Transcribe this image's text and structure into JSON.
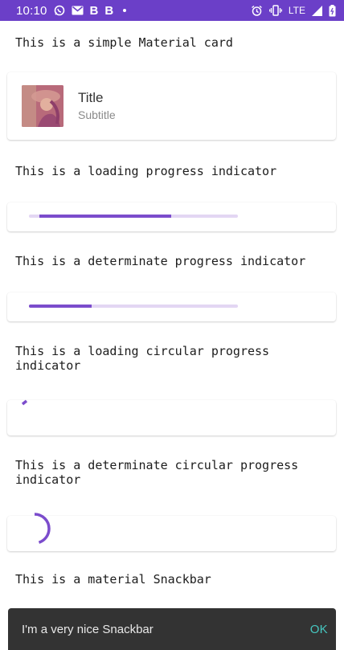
{
  "status_bar": {
    "time": "10:10",
    "left_icons": [
      "whatsapp-icon",
      "gmail-icon",
      "b-app-icon",
      "b-app-icon",
      "dot-icon"
    ],
    "b_label": "B",
    "network_label": "LTE",
    "right_icons": [
      "alarm-icon",
      "vibrate-icon",
      "signal-icon",
      "battery-icon"
    ]
  },
  "sections": {
    "simple_card": {
      "title": "This is a simple Material card",
      "card_title": "Title",
      "card_subtitle": "Subtitle"
    },
    "loading_linear": {
      "title": "This is a loading progress indicator",
      "progress_start": 0.05,
      "progress_end": 0.68
    },
    "determinate_linear": {
      "title": "This is a determinate progress indicator",
      "progress": 0.3
    },
    "loading_circular": {
      "title": "This is a loading circular progress indicator"
    },
    "determinate_circular": {
      "title": "This is a determinate circular progress indicator",
      "progress": 0.45
    },
    "snackbar_section": {
      "title": "This is a material Snackbar"
    }
  },
  "snackbar": {
    "message": "I'm a very nice Snackbar",
    "action": "OK"
  },
  "colors": {
    "status_bar": "#6b3fc8",
    "accent": "#7b4ccc",
    "track": "#e3d6f3",
    "snackbar_bg": "#333333",
    "snackbar_action": "#46c7c0"
  }
}
